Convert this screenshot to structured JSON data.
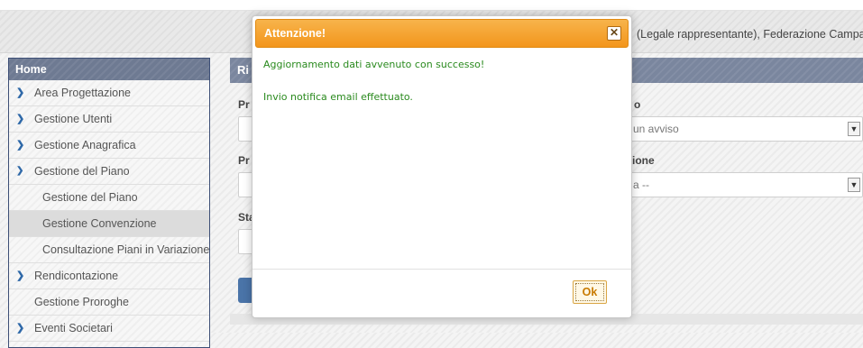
{
  "header": {
    "user_text": "(Legale rappresentante), Federazione Campana"
  },
  "sidebar": {
    "home": "Home",
    "items": [
      {
        "label": "Area Progettazione",
        "icon": "chevron-right-icon"
      },
      {
        "label": "Gestione Utenti",
        "icon": "chevron-right-icon"
      },
      {
        "label": "Gestione Anagrafica",
        "icon": "chevron-right-icon"
      },
      {
        "label": "Gestione del Piano",
        "icon": "chevron-down-icon"
      },
      {
        "label": "Gestione del Piano",
        "icon": ""
      },
      {
        "label": "Gestione Convenzione",
        "icon": ""
      },
      {
        "label": "Consultazione Piani in Variazione",
        "icon": ""
      },
      {
        "label": "Rendicontazione",
        "icon": "chevron-right-icon"
      },
      {
        "label": "Gestione Proroghe",
        "icon": ""
      },
      {
        "label": "Eventi Societari",
        "icon": "chevron-right-icon"
      }
    ]
  },
  "main": {
    "panel_title": "Ri",
    "labels": [
      "Pr",
      "Pr",
      "Sta"
    ],
    "right_labels": [
      "o",
      "zione"
    ],
    "right_values": [
      "un avviso",
      "a --"
    ]
  },
  "dialog": {
    "title": "Attenzione!",
    "close_icon": "close-icon",
    "message1": "Aggiornamento dati avvenuto con successo!",
    "message2": "Invio notifica email effettuato.",
    "ok_label": "Ok"
  },
  "colors": {
    "accent_orange": "#f3961c",
    "success_green": "#2a8a1e",
    "sidebar_header": "#6e7a92"
  }
}
